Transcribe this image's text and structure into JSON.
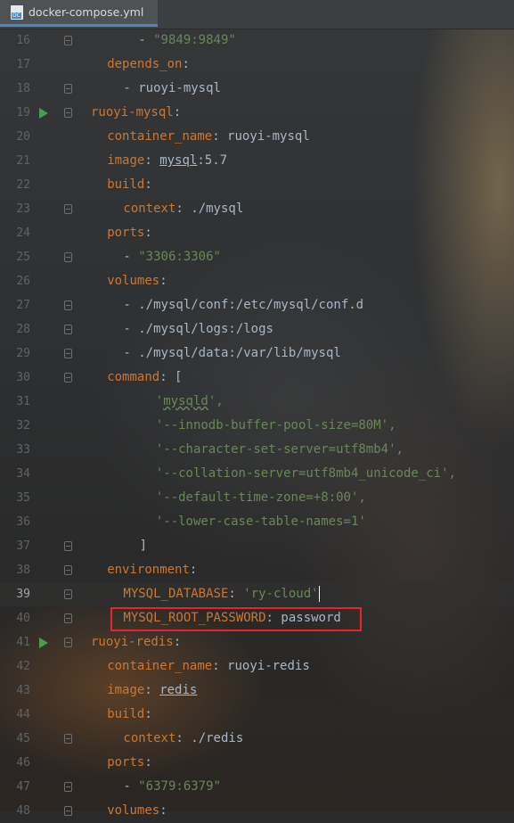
{
  "tab": {
    "label": "docker-compose.yml",
    "icon": "DC"
  },
  "lines": [
    {
      "n": "16",
      "parts": [
        {
          "t": "  "
        },
        {
          "t": "- "
        },
        {
          "s": "\"9849:9849\""
        }
      ],
      "indent": 2
    },
    {
      "n": "17",
      "parts": [
        {
          "k": "depends_on"
        },
        {
          "t": ":"
        }
      ],
      "indent": 1
    },
    {
      "n": "18",
      "parts": [
        {
          "t": "- ruoyi-mysql"
        }
      ],
      "indent": 2
    },
    {
      "n": "19",
      "parts": [
        {
          "k": "ruoyi-mysql"
        },
        {
          "t": ":"
        }
      ],
      "indent": 0,
      "run": true
    },
    {
      "n": "20",
      "parts": [
        {
          "k": "container_name"
        },
        {
          "t": ": ruoyi-mysql"
        }
      ],
      "indent": 1
    },
    {
      "n": "21",
      "parts": [
        {
          "k": "image"
        },
        {
          "t": ": "
        },
        {
          "u": "mysql"
        },
        {
          "t": ":5.7"
        }
      ],
      "indent": 1
    },
    {
      "n": "22",
      "parts": [
        {
          "k": "build"
        },
        {
          "t": ":"
        }
      ],
      "indent": 1
    },
    {
      "n": "23",
      "parts": [
        {
          "k": "context"
        },
        {
          "t": ": ./mysql"
        }
      ],
      "indent": 2
    },
    {
      "n": "24",
      "parts": [
        {
          "k": "ports"
        },
        {
          "t": ":"
        }
      ],
      "indent": 1
    },
    {
      "n": "25",
      "parts": [
        {
          "t": "- "
        },
        {
          "s": "\"3306:3306\""
        }
      ],
      "indent": 2
    },
    {
      "n": "26",
      "parts": [
        {
          "k": "volumes"
        },
        {
          "t": ":"
        }
      ],
      "indent": 1
    },
    {
      "n": "27",
      "parts": [
        {
          "t": "- ./mysql/conf:/etc/mysql/conf.d"
        }
      ],
      "indent": 2
    },
    {
      "n": "28",
      "parts": [
        {
          "t": "- ./mysql/logs:/logs"
        }
      ],
      "indent": 2
    },
    {
      "n": "29",
      "parts": [
        {
          "t": "- ./mysql/data:/var/lib/mysql"
        }
      ],
      "indent": 2
    },
    {
      "n": "30",
      "parts": [
        {
          "k": "command"
        },
        {
          "t": ": ["
        }
      ],
      "indent": 1
    },
    {
      "n": "31",
      "parts": [
        {
          "s": "'"
        },
        {
          "w": "mysqld"
        },
        {
          "s": "',"
        }
      ],
      "indent": 4
    },
    {
      "n": "32",
      "parts": [
        {
          "s": "'--innodb-buffer-pool-size=80M',"
        }
      ],
      "indent": 4
    },
    {
      "n": "33",
      "parts": [
        {
          "s": "'--character-set-server=utf8mb4',"
        }
      ],
      "indent": 4
    },
    {
      "n": "34",
      "parts": [
        {
          "s": "'--collation-server=utf8mb4_unicode_ci',"
        }
      ],
      "indent": 4
    },
    {
      "n": "35",
      "parts": [
        {
          "s": "'--default-time-zone=+8:00',"
        }
      ],
      "indent": 4
    },
    {
      "n": "36",
      "parts": [
        {
          "s": "'--lower-case-table-names=1'"
        }
      ],
      "indent": 4
    },
    {
      "n": "37",
      "parts": [
        {
          "t": "]"
        }
      ],
      "indent": 3
    },
    {
      "n": "38",
      "parts": [
        {
          "k": "environment"
        },
        {
          "t": ":"
        }
      ],
      "indent": 1
    },
    {
      "n": "39",
      "parts": [
        {
          "k": "MYSQL_DATABASE"
        },
        {
          "t": ": "
        },
        {
          "s": "'ry-cloud'"
        },
        {
          "caret": true
        }
      ],
      "indent": 2,
      "current": true
    },
    {
      "n": "40",
      "parts": [
        {
          "k": "MYSQL_ROOT_PASSWORD"
        },
        {
          "t": ": password"
        }
      ],
      "indent": 2
    },
    {
      "n": "41",
      "parts": [
        {
          "k": "ruoyi-redis"
        },
        {
          "t": ":"
        }
      ],
      "indent": 0,
      "run": true
    },
    {
      "n": "42",
      "parts": [
        {
          "k": "container_name"
        },
        {
          "t": ": ruoyi-redis"
        }
      ],
      "indent": 1
    },
    {
      "n": "43",
      "parts": [
        {
          "k": "image"
        },
        {
          "t": ": "
        },
        {
          "u": "redis"
        }
      ],
      "indent": 1
    },
    {
      "n": "44",
      "parts": [
        {
          "k": "build"
        },
        {
          "t": ":"
        }
      ],
      "indent": 1
    },
    {
      "n": "45",
      "parts": [
        {
          "k": "context"
        },
        {
          "t": ": ./redis"
        }
      ],
      "indent": 2
    },
    {
      "n": "46",
      "parts": [
        {
          "k": "ports"
        },
        {
          "t": ":"
        }
      ],
      "indent": 1
    },
    {
      "n": "47",
      "parts": [
        {
          "t": "- "
        },
        {
          "s": "\"6379:6379\""
        }
      ],
      "indent": 2
    },
    {
      "n": "48",
      "parts": [
        {
          "k": "volumes"
        },
        {
          "t": ":"
        }
      ],
      "indent": 1
    }
  ],
  "highlight_line": "40",
  "colors": {
    "keyword": "#cc7832",
    "string": "#6a8759",
    "text": "#a9b7c6",
    "highlight_box": "#e5242b",
    "run_marker": "#499c54"
  }
}
